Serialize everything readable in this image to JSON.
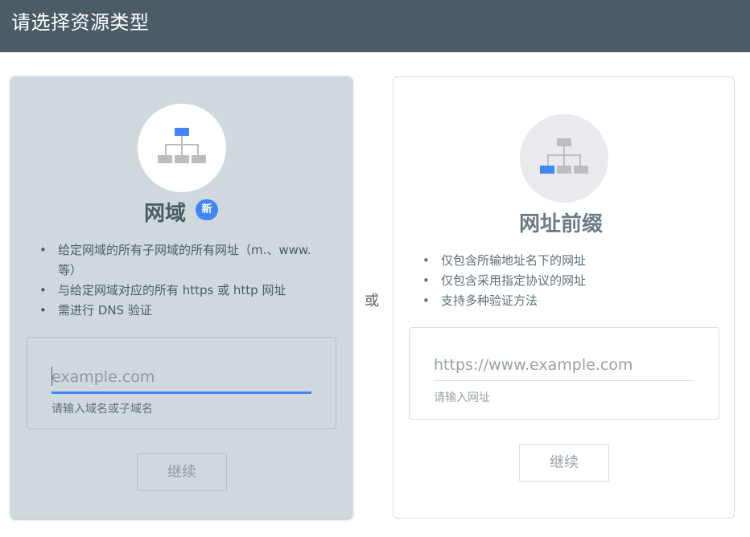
{
  "header": {
    "title": "请选择资源类型"
  },
  "domain_card": {
    "icon": "sitemap-icon",
    "title": "网域",
    "badge": "新",
    "features": [
      "给定网域的所有子网域的所有网址（m.、www. 等）",
      "与给定网域对应的所有 https 或 http 网址",
      "需进行 DNS 验证"
    ],
    "input": {
      "value": "",
      "placeholder": "example.com",
      "hint": "请输入域名或子域名"
    },
    "continue_label": "继续"
  },
  "or_label": "或",
  "prefix_card": {
    "icon": "sitemap-icon",
    "title": "网址前缀",
    "features": [
      "仅包含所输地址名下的网址",
      "仅包含采用指定协议的网址",
      "支持多种验证方法"
    ],
    "input": {
      "value": "",
      "placeholder": "https://www.example.com",
      "hint": "请输入网址"
    },
    "continue_label": "继续"
  },
  "colors": {
    "header_bg": "#4b5c67",
    "selected_card_bg": "#cfd8dd",
    "accent": "#4285f4",
    "icon_gray": "#bdbdbd"
  }
}
